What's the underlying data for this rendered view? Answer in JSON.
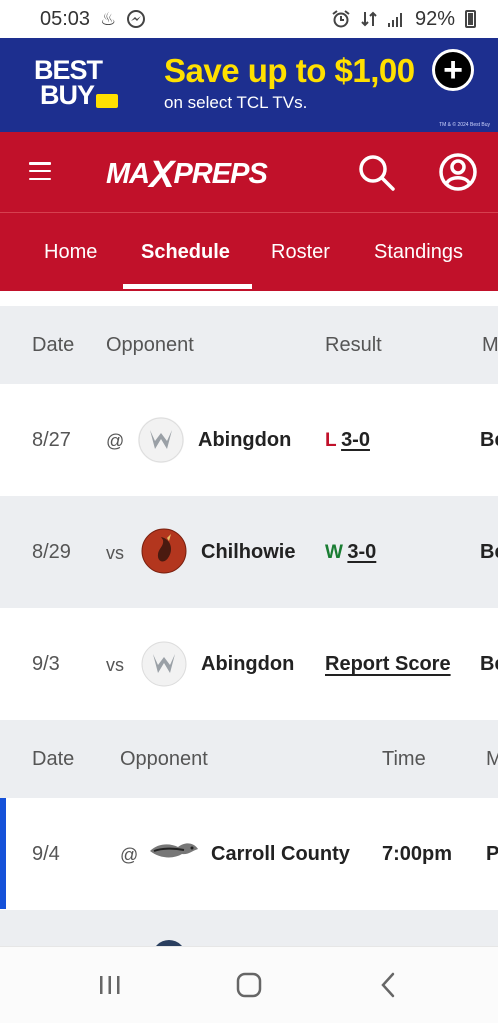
{
  "status_bar": {
    "time": "05:03",
    "battery": "92%"
  },
  "ad": {
    "brand_line1": "BEST",
    "brand_line2": "BUY",
    "headline": "Save up to $1,00",
    "subline": "on select TCL TVs.",
    "fine_print": "TM & © 2024 Best Buy",
    "colors": {
      "background": "#1d2f8f",
      "headline": "#ffe000"
    }
  },
  "header": {
    "logo_left": "MA",
    "logo_x": "X",
    "logo_right": "PREPS",
    "color": "#c1112a"
  },
  "tabs": [
    {
      "label": "Home"
    },
    {
      "label": "Schedule",
      "active": true
    },
    {
      "label": "Roster"
    },
    {
      "label": "Standings"
    }
  ],
  "results_table": {
    "headers": {
      "date": "Date",
      "opponent": "Opponent",
      "result": "Result",
      "more": "M"
    },
    "rows": [
      {
        "date": "8/27",
        "venue": "@",
        "opponent": "Abingdon",
        "outcome": "L",
        "score": "3-0",
        "extra": "Be"
      },
      {
        "date": "8/29",
        "venue": "vs",
        "opponent": "Chilhowie",
        "outcome": "W",
        "score": "3-0",
        "extra": "Be"
      },
      {
        "date": "9/3",
        "venue": "vs",
        "opponent": "Abingdon",
        "report": "Report Score",
        "extra": "Be"
      }
    ]
  },
  "upcoming_table": {
    "headers": {
      "date": "Date",
      "opponent": "Opponent",
      "time": "Time",
      "more": "M"
    },
    "rows": [
      {
        "date": "9/4",
        "venue": "@",
        "opponent": "Carroll County",
        "time": "7:00pm",
        "extra": "P",
        "highlighted": true
      }
    ]
  },
  "icons": {
    "menu": "hamburger-menu-icon",
    "search": "search-icon",
    "account": "account-icon",
    "ad_close": "plus-circle-icon",
    "nav_recents": "recent-apps-icon",
    "nav_home": "home-icon",
    "nav_back": "back-icon"
  }
}
